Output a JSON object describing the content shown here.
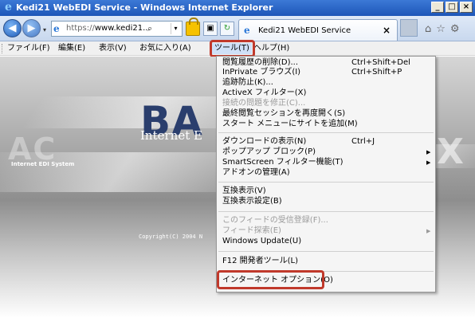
{
  "window": {
    "title": "Kedi21 WebEDI Service - Windows Internet Explorer",
    "buttons": [
      "_",
      "□",
      "×"
    ]
  },
  "navbar": {
    "back_symbol": "◀",
    "forward_symbol": "▶",
    "address_protocol": "https://",
    "address_host": "www.kedi21...",
    "address_search_glyph": "⌕",
    "dropdown_glyph": "▾",
    "tab_title": "Kedi21 WebEDI Service",
    "tab_close": "×",
    "right_icons": [
      "⌂",
      "☆",
      "⚙"
    ]
  },
  "menubar": {
    "items": [
      "ファイル(F)",
      "編集(E)",
      "表示(V)",
      "お気に入り(A)",
      "ツール(T)",
      "ヘルプ(H)"
    ]
  },
  "tools_menu": {
    "items": [
      {
        "label": "閲覧履歴の削除(D)...",
        "shortcut": "Ctrl+Shift+Del",
        "enabled": true
      },
      {
        "label": "InPrivate ブラウズ(I)",
        "shortcut": "Ctrl+Shift+P",
        "enabled": true
      },
      {
        "label": "追跡防止(K)...",
        "shortcut": "",
        "enabled": true
      },
      {
        "label": "ActiveX フィルター(X)",
        "shortcut": "",
        "enabled": true
      },
      {
        "label": "接続の問題を修正(C)...",
        "shortcut": "",
        "enabled": false
      },
      {
        "label": "最終閲覧セッションを再度開く(S)",
        "shortcut": "",
        "enabled": true
      },
      {
        "label": "スタート メニューにサイトを追加(M)",
        "shortcut": "",
        "enabled": true
      },
      {
        "label": "ダウンロードの表示(N)",
        "shortcut": "Ctrl+J",
        "enabled": true
      },
      {
        "label": "ポップアップ ブロック(P)",
        "shortcut": "",
        "enabled": true,
        "submenu": true
      },
      {
        "label": "SmartScreen フィルター機能(T)",
        "shortcut": "",
        "enabled": true,
        "submenu": true
      },
      {
        "label": "アドオンの管理(A)",
        "shortcut": "",
        "enabled": true
      },
      {
        "label": "互換表示(V)",
        "shortcut": "",
        "enabled": true
      },
      {
        "label": "互換表示設定(B)",
        "shortcut": "",
        "enabled": true
      },
      {
        "label": "このフィードの受信登録(F)...",
        "shortcut": "",
        "enabled": false
      },
      {
        "label": "フィード探索(E)",
        "shortcut": "",
        "enabled": false,
        "submenu": true
      },
      {
        "label": "Windows Update(U)",
        "shortcut": "",
        "enabled": true
      },
      {
        "label": "F12 開発者ツール(L)",
        "shortcut": "",
        "enabled": true
      },
      {
        "label": "インターネット オプション(O)",
        "shortcut": "",
        "enabled": true
      }
    ],
    "submenu_arrow": "▶"
  },
  "page": {
    "logo_text": "BA",
    "subtitle": "Internet E",
    "system_label": "Internet EDI System",
    "ac_text": "AC",
    "copyright": "Copyright(C) 2004 N",
    "right_mark": "X"
  },
  "colors": {
    "highlight_border": "#c0392b",
    "titlebar": "#1d56b8"
  }
}
